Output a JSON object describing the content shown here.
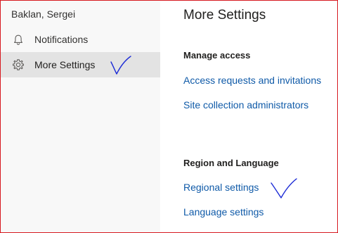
{
  "sidebar": {
    "user_name": "Baklan, Sergei",
    "items": [
      {
        "label": "Notifications",
        "icon": "bell-icon",
        "selected": false
      },
      {
        "label": "More Settings",
        "icon": "gear-icon",
        "selected": true
      }
    ]
  },
  "main": {
    "title": "More Settings",
    "sections": [
      {
        "title": "Manage access",
        "links": [
          "Access requests and invitations",
          "Site collection administrators"
        ]
      },
      {
        "title": "Region and Language",
        "links": [
          "Regional settings",
          "Language settings"
        ]
      }
    ]
  },
  "colors": {
    "border": "#d71920",
    "sidebar_bg": "#f8f8f8",
    "selected_bg": "#e3e3e3",
    "link": "#0f5aa8",
    "annotation": "#1c2bd6"
  }
}
